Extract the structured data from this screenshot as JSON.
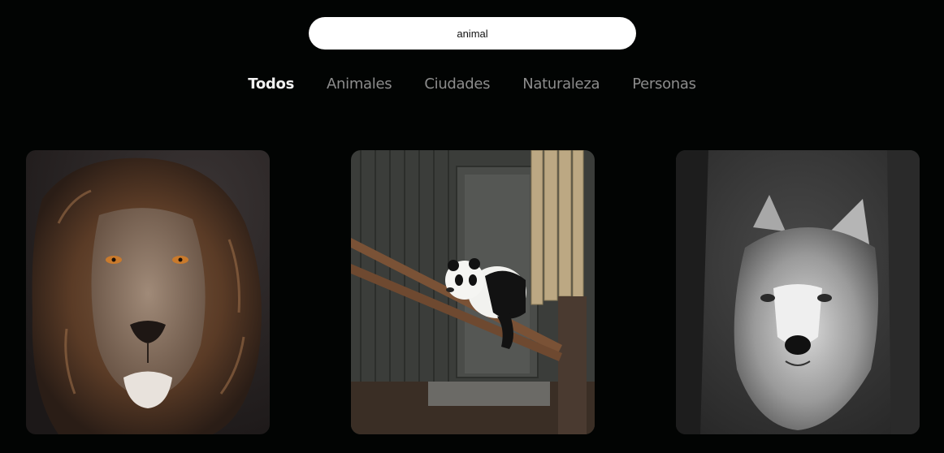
{
  "search": {
    "value": "animal"
  },
  "tabs": [
    {
      "label": "Todos",
      "active": true
    },
    {
      "label": "Animales",
      "active": false
    },
    {
      "label": "Ciudades",
      "active": false
    },
    {
      "label": "Naturaleza",
      "active": false
    },
    {
      "label": "Personas",
      "active": false
    }
  ],
  "gallery": [
    {
      "subject": "lion"
    },
    {
      "subject": "panda"
    },
    {
      "subject": "wolf"
    }
  ],
  "colors": {
    "background": "#020403",
    "search_bg": "#ffffff",
    "tab_active": "#f1f1f1",
    "tab_inactive": "#8c8c8c"
  }
}
